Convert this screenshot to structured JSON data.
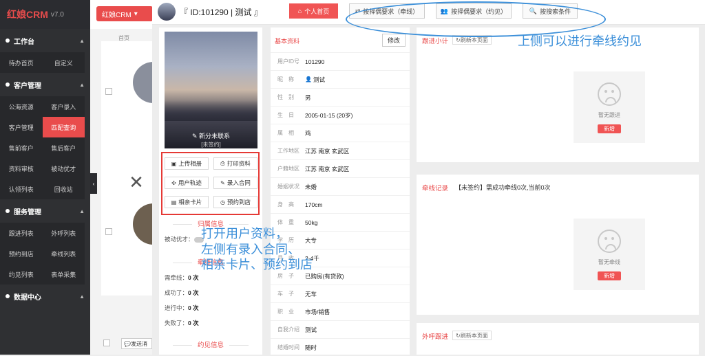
{
  "sidebar": {
    "brand": "红娘CRM",
    "version": "v7.0",
    "sections": [
      {
        "title": "工作台",
        "items": [
          "待办首页",
          "自定义"
        ]
      },
      {
        "title": "客户管理",
        "items": [
          "公海资源",
          "客户录入",
          "客户管理",
          "匹配查询",
          "售前客户",
          "售后客户",
          "资料审核",
          "被动优才",
          "认领列表",
          "回收站"
        ]
      },
      {
        "title": "服务管理",
        "items": [
          "跟进列表",
          "外呼列表",
          "预约到店",
          "牵线列表",
          "约见列表",
          "表单采集"
        ]
      },
      {
        "title": "数据中心",
        "items": []
      }
    ]
  },
  "background": {
    "crm_button": "红娘CRM",
    "tab_home": "首页",
    "send_label": "发送消",
    "collapse_icon": "chevron-left"
  },
  "modal": {
    "title": "『 ID:101290 | 测试 』",
    "header_buttons": [
      "个人首页",
      "按择偶要求（牵线）",
      "按择偶要求（约见）",
      "按搜索条件"
    ],
    "photo_caption": "新分未联系",
    "photo_subcaption": "[未签约]",
    "action_buttons": [
      "上传相册",
      "打印资料",
      "用户轨迹",
      "录入合同",
      "相亲卡片",
      "预约到店"
    ],
    "belong_title": "归属信息",
    "passive_label": "被动优才：",
    "match_title": "牵线信息",
    "match_rows": [
      {
        "label": "需牵线：",
        "value": "0 次"
      },
      {
        "label": "成功了：",
        "value": "0 次"
      },
      {
        "label": "进行中：",
        "value": "0 次"
      },
      {
        "label": "失败了：",
        "value": "0 次"
      }
    ],
    "meet_title": "约见信息",
    "basic": {
      "title": "基本资料",
      "edit": "修改",
      "fields": [
        {
          "label": "用户ID号",
          "value": "101290"
        },
        {
          "label": "昵　称",
          "value": "测试"
        },
        {
          "label": "性　别",
          "value": "男"
        },
        {
          "label": "生　日",
          "value": "2005-01-15 (20岁)"
        },
        {
          "label": "属　相",
          "value": "鸡"
        },
        {
          "label": "工作地区",
          "value": "江苏 南京 玄武区"
        },
        {
          "label": "户籍地区",
          "value": "江苏 南京 玄武区"
        },
        {
          "label": "婚姻状况",
          "value": "未婚"
        },
        {
          "label": "身　高",
          "value": "170cm"
        },
        {
          "label": "体　重",
          "value": "50kg"
        },
        {
          "label": "学　历",
          "value": "大专"
        },
        {
          "label": "月　收",
          "value": "2-4千"
        },
        {
          "label": "房　子",
          "value": "已购房(有贷款)"
        },
        {
          "label": "车　子",
          "value": "无车"
        },
        {
          "label": "职　业",
          "value": "市场/销售"
        },
        {
          "label": "自我介绍",
          "value": "测试"
        },
        {
          "label": "结婚时间",
          "value": "随时"
        }
      ]
    },
    "followup": {
      "title": "跟进小计",
      "refresh": "刷新本页面",
      "empty": "暂无跟进",
      "new": "新增"
    },
    "match_record": {
      "title": "牵线记录",
      "summary": "【未签约】需成功牵线0次,当前0次",
      "empty": "暂无牵线",
      "new": "新增"
    },
    "outcall": {
      "title": "外呼跟进",
      "refresh": "刷新本页面"
    }
  },
  "annotations": {
    "top": "上侧可以进行牵线约见",
    "left_line1": "打开用户资料，",
    "left_line2": "左侧有录入合同、",
    "left_line3": "相亲卡片、预约到店"
  },
  "colors": {
    "accent": "#e94c4c",
    "annotation": "#3b8fd9",
    "sidebar": "#2f3033"
  }
}
